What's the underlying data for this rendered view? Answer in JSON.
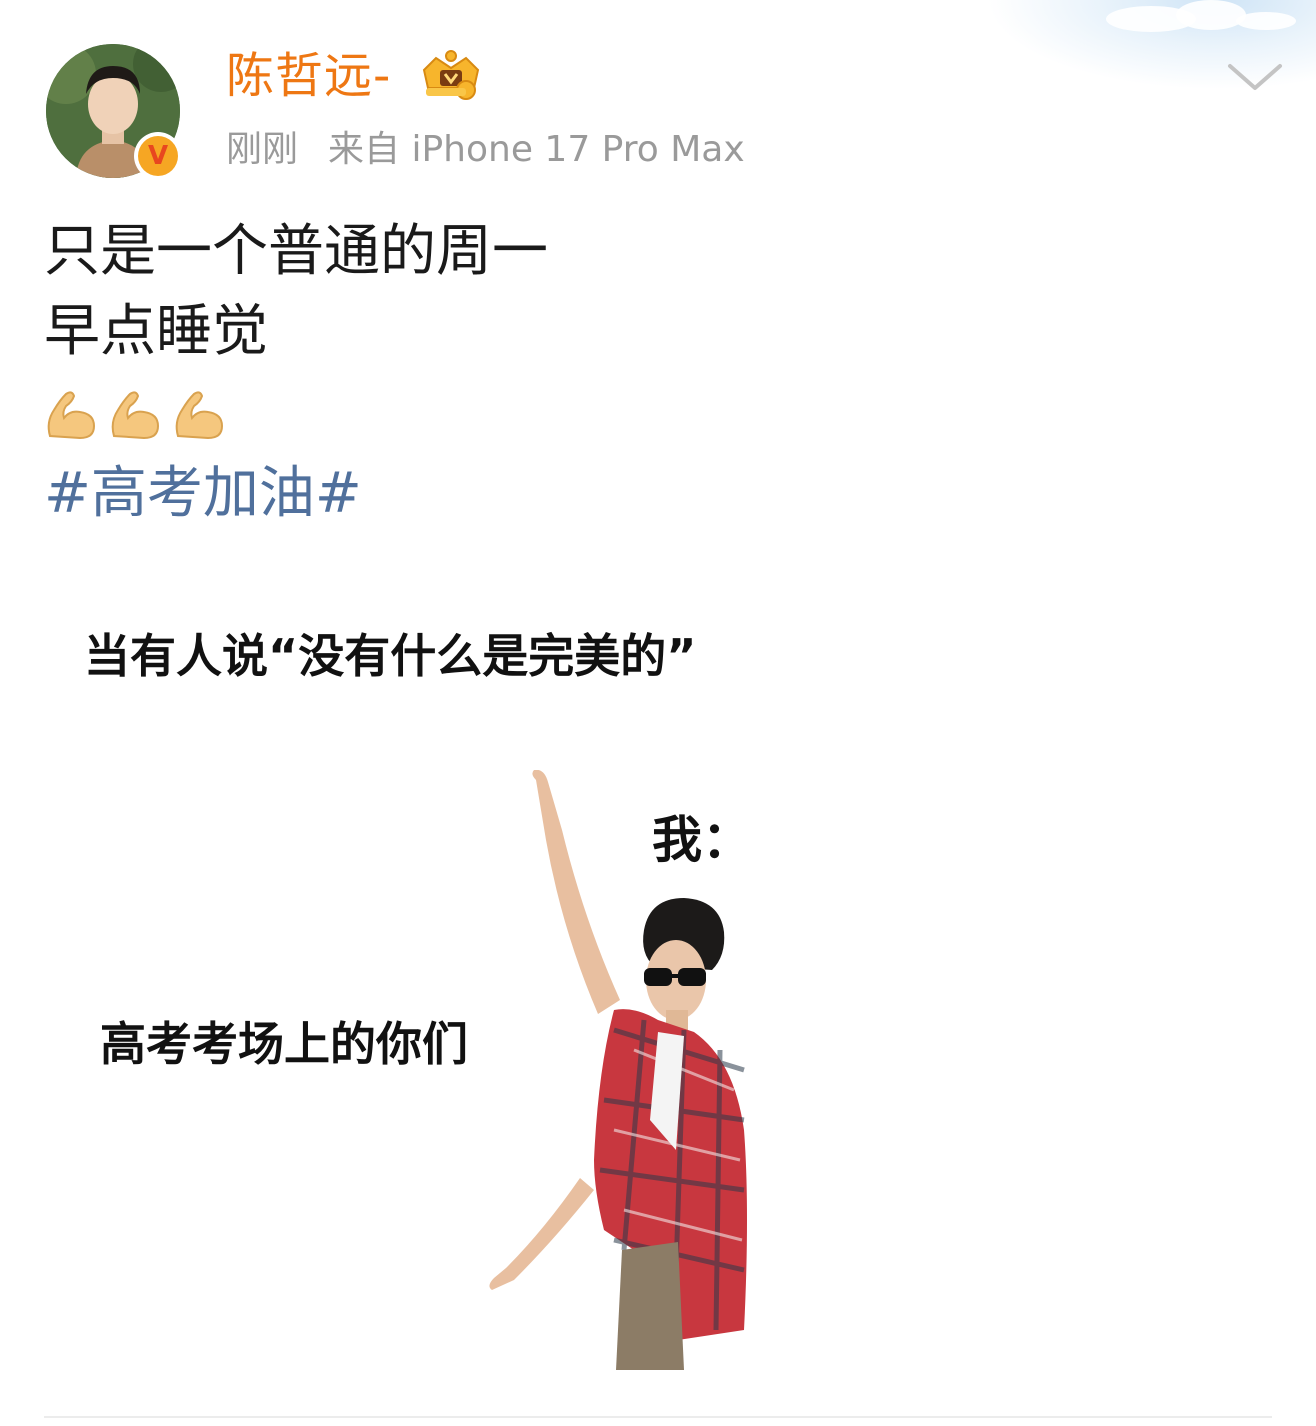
{
  "post": {
    "author": {
      "name": "陈哲远-",
      "verified": true,
      "vip_badge_icon": "crown-vip-icon"
    },
    "meta": {
      "time": "刚刚",
      "source": "来自 iPhone 17 Pro Max"
    },
    "text_lines": [
      "只是一个普通的周一",
      "早点睡觉"
    ],
    "emojis": [
      "💪",
      "💪",
      "💪"
    ],
    "hashtag": "#高考加油#",
    "image": {
      "caption_top": "当有人说“没有什么是完美的”",
      "label_me": "我：",
      "label_you": "高考考场上的你们"
    },
    "menu_icon": "chevron-down-icon"
  },
  "colors": {
    "username": "#ee7713",
    "meta": "#9a9a9a",
    "hashtag": "#50709c",
    "text": "#1a1a1a"
  }
}
